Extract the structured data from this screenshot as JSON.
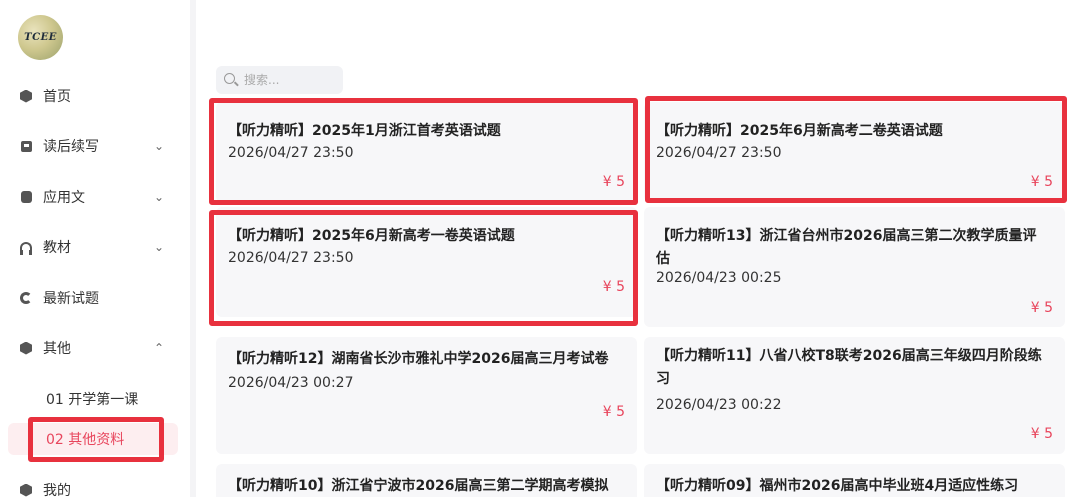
{
  "sidebar": {
    "logo_text": "TCEE",
    "items": [
      {
        "label": "首页",
        "icon": "cube-icon"
      },
      {
        "label": "读后续写",
        "icon": "book-icon",
        "chevron": "⌄"
      },
      {
        "label": "应用文",
        "icon": "cylinder-icon",
        "chevron": "⌄"
      },
      {
        "label": "教材",
        "icon": "headset-icon",
        "chevron": "⌄"
      },
      {
        "label": "最新试题",
        "icon": "ring-icon"
      },
      {
        "label": "其他",
        "icon": "cube-icon",
        "chevron": "⌃"
      },
      {
        "label": "我的",
        "icon": "user-icon"
      }
    ],
    "sub_items": [
      {
        "label": "01 开学第一课"
      },
      {
        "label": "02 其他资料",
        "active": true
      }
    ]
  },
  "search": {
    "placeholder": "搜索..."
  },
  "cards": [
    {
      "title": "【听力精听】2025年1月浙江首考英语试题",
      "date": "2026/04/27 23:50",
      "price": "¥ 5"
    },
    {
      "title": "【听力精听】2025年6月新高考二卷英语试题",
      "date": "2026/04/27 23:50",
      "price": "¥ 5"
    },
    {
      "title": "【听力精听】2025年6月新高考一卷英语试题",
      "date": "2026/04/27 23:50",
      "price": "¥ 5"
    },
    {
      "title": "【听力精听13】浙江省台州市2026届高三第二次教学质量评估",
      "date": "2026/04/23 00:25",
      "price": "¥ 5"
    },
    {
      "title": "【听力精听12】湖南省长沙市雅礼中学2026届高三月考试卷",
      "date": "2026/04/23 00:27",
      "price": "¥ 5"
    },
    {
      "title": "【听力精听11】八省八校T8联考2026届高三年级四月阶段练习",
      "date": "2026/04/23 00:22",
      "price": "¥ 5"
    },
    {
      "title": "【听力精听10】浙江省宁波市2026届高三第二学期高考模拟",
      "date": "",
      "price": ""
    },
    {
      "title": "【听力精听09】福州市2026届高中毕业班4月适应性练习",
      "date": "",
      "price": ""
    }
  ],
  "colors": {
    "accent": "#e8465d",
    "highlight": "#e8313e"
  }
}
